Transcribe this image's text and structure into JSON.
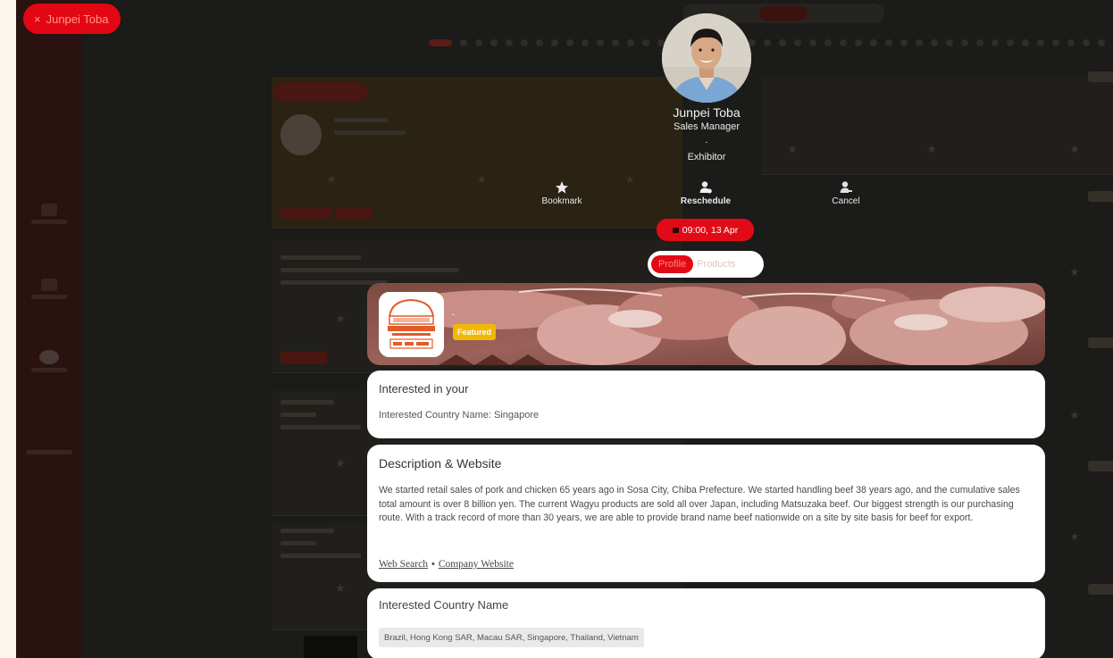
{
  "user_pill": {
    "close_glyph": "×",
    "label": "Junpei Toba"
  },
  "profile": {
    "name": "Junpei Toba",
    "title": "Sales Manager",
    "separator": "-",
    "type": "Exhibitor"
  },
  "actions": [
    {
      "label": "Bookmark",
      "icon": "star-icon"
    },
    {
      "label": "Reschedule",
      "icon": "person-clock-icon"
    },
    {
      "label": "Cancel",
      "icon": "person-remove-icon"
    }
  ],
  "meeting": {
    "time": "09:00, 13 Apr",
    "icon": "calendar-icon"
  },
  "tabs": {
    "profile": "Profile",
    "products": "Products",
    "active": "Profile"
  },
  "banner": {
    "badge": "Featured",
    "dash": "-"
  },
  "interest": {
    "heading": "Interested in your",
    "text": "Interested Country Name: Singapore"
  },
  "description": {
    "heading": "Description & Website",
    "text": "We started retail sales of pork and chicken 65 years ago in Sosa City, Chiba Prefecture. We started handling beef 38 years ago, and the cumulative sales total amount is over 8 billion yen. The current Wagyu products are sold all over Japan, including Matsuzaka beef. Our biggest strength is our purchasing route. With a track record of more than 30 years, we are able to provide brand name beef nationwide on a site by site basis for beef for export.",
    "link1": "Web Search",
    "link_separator": "•",
    "link2": "Company Website"
  },
  "countries": {
    "heading": "Interested Country Name",
    "tag": "Brazil, Hong Kong SAR, Macau SAR, Singapore, Thailand, Vietnam"
  },
  "colors": {
    "accent": "#e20a17",
    "featured": "#f2b705",
    "overlay": "#181816"
  }
}
